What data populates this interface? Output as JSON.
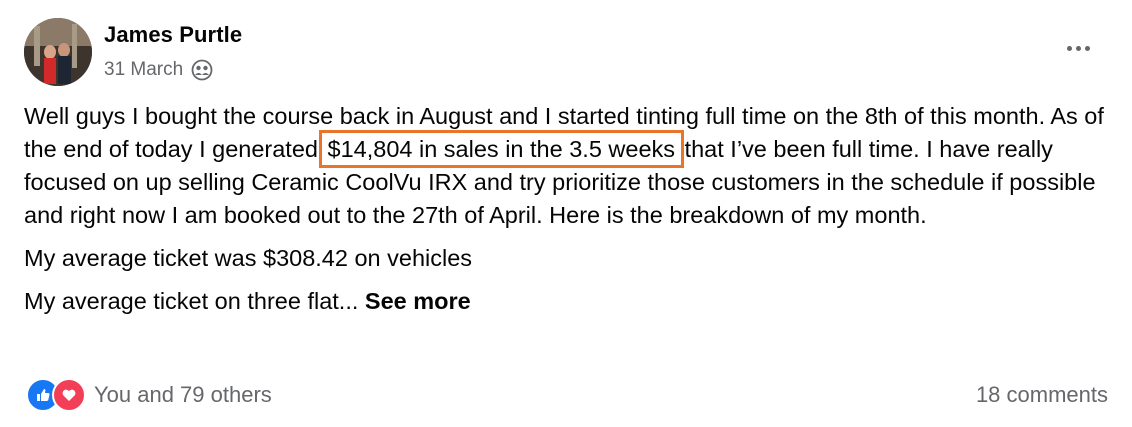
{
  "post": {
    "author": "James Purtle",
    "date": "31 March",
    "body": {
      "p1_before": "Well guys I bought the course back in August and I started tinting full time on the 8th of this month. As of the end of today I generated ",
      "p1_highlight": "$14,804  in sales in the 3.5 weeks",
      "p1_after": " that I’ve been full time. I have really focused on up selling Ceramic CoolVu IRX and try prioritize those customers in the schedule if possible and right now I am booked out to the 27th of April. Here is the breakdown of my month.",
      "p2": "My average ticket was $308.42 on vehicles",
      "p3_text": "My average ticket on three flat... ",
      "see_more": "See more"
    },
    "highlight_color": "#e8752a",
    "reactions_text": "You and 79 others",
    "comments_text": "18 comments",
    "icons": {
      "audience": "friends-group-icon",
      "more": "more-options-icon",
      "like": "like-reaction-icon",
      "love": "love-reaction-icon"
    }
  }
}
